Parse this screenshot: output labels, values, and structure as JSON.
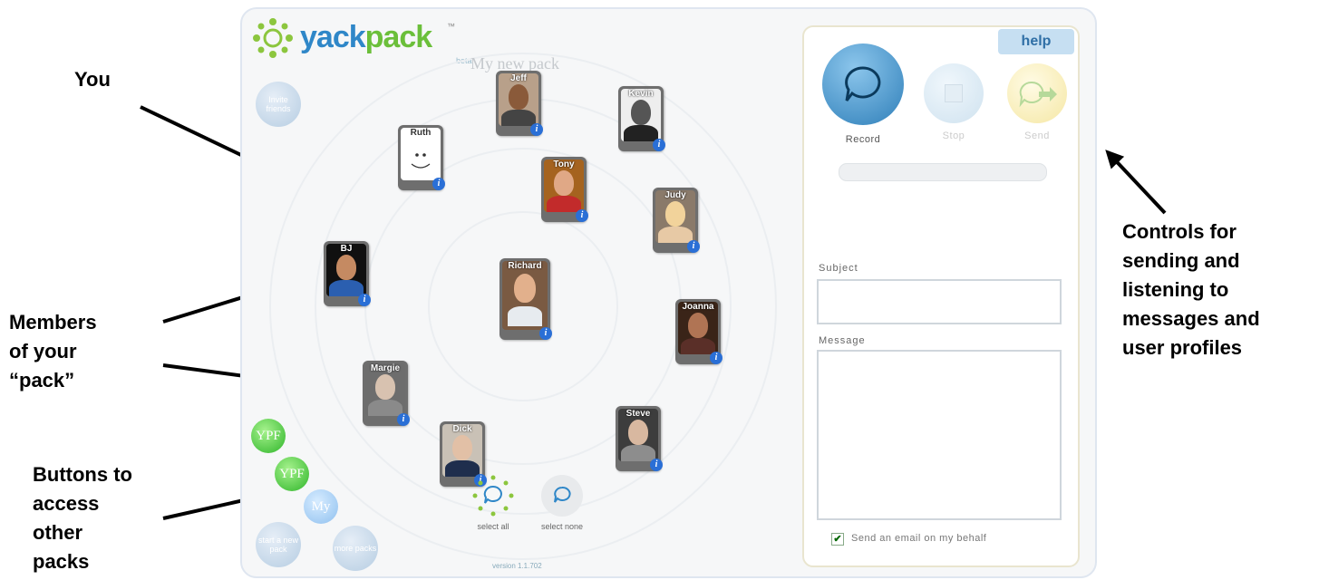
{
  "annotations": {
    "you": "You",
    "members": [
      "Members",
      "of your",
      "“pack”"
    ],
    "buttons": [
      "Buttons to",
      "access",
      "other",
      "packs"
    ],
    "controls": [
      "Controls for",
      "sending and",
      "listening to",
      "messages and",
      "user profiles"
    ]
  },
  "app": {
    "logo_yack": "yack",
    "logo_pack": "pack",
    "logo_beta": "beta",
    "logo_tm": "™",
    "pack_title": "My new pack",
    "invite_label": "Invite friends",
    "start_pack_label": "start a new pack",
    "more_packs_label": "more packs",
    "pack_buttons": [
      "YPF",
      "YPF",
      "My"
    ],
    "select_all": "select all",
    "select_none": "select none",
    "version": "version 1.1.702"
  },
  "members": [
    {
      "name": "Jeff"
    },
    {
      "name": "Kevin"
    },
    {
      "name": "Ruth"
    },
    {
      "name": "Tony"
    },
    {
      "name": "Judy"
    },
    {
      "name": "BJ"
    },
    {
      "name": "Richard"
    },
    {
      "name": "Joanna"
    },
    {
      "name": "Margie"
    },
    {
      "name": "Dick"
    },
    {
      "name": "Steve"
    }
  ],
  "info_glyph": "i",
  "panel": {
    "help": "help",
    "record": "Record",
    "stop": "Stop",
    "send": "Send",
    "subject_label": "Subject",
    "message_label": "Message",
    "checkbox_checked": "✔",
    "email_label": "Send an email on my behalf"
  },
  "colors": {
    "accent_blue": "#2f87c8",
    "accent_green": "#6bbf3a",
    "info_blue": "#2a6fd6"
  }
}
